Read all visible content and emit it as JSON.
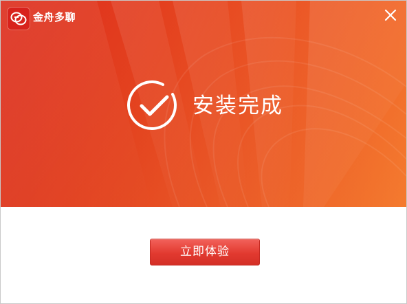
{
  "window": {
    "app_title": "金舟多聊",
    "close_icon": "close-icon",
    "logo_icon": "chat-bubbles-logo-icon"
  },
  "banner": {
    "status_icon": "check-circle-icon",
    "status_text": "安装完成",
    "colors": {
      "gradient_start": "#e8321f",
      "gradient_end": "#f47a2e"
    }
  },
  "actions": {
    "primary_label": "立即体验",
    "primary_color": "#e23a30"
  }
}
